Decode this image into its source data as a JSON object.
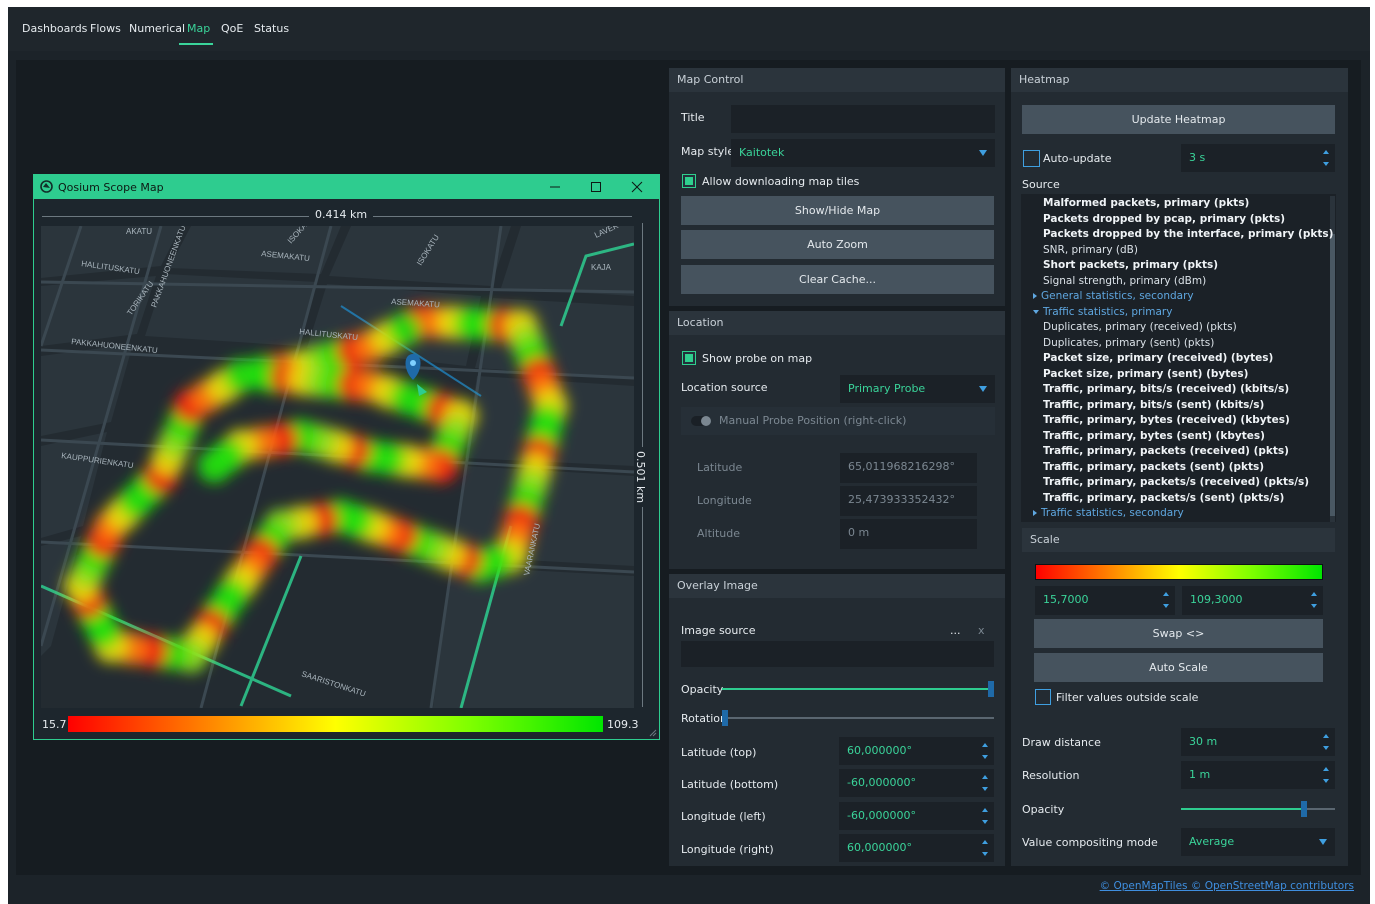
{
  "nav": {
    "items": [
      "Dashboards",
      "Flows",
      "Numerical",
      "Map",
      "QoE",
      "Status"
    ],
    "active": "Map"
  },
  "map_window": {
    "title": "Qosium Scope Map",
    "scale_horizontal": "0.414 km",
    "scale_vertical": "0.501 km",
    "legend_min": "15.7",
    "legend_max": "109.3",
    "streets": [
      "HALLITUSKATU",
      "ASEMAKATU",
      "TORIKATU",
      "ASEMAKATU",
      "HALLITUSKATU",
      "PAKKAHUONEENKATU",
      "KAUPPURIENKATU",
      "VAARANKATU",
      "SAARISTONKATU",
      "ISOKATU",
      "KAJA",
      "LAVEK",
      "ISOKATU",
      "AKATU",
      "PAKKAHUONEENKATU"
    ]
  },
  "map_control": {
    "header": "Map Control",
    "title_label": "Title",
    "title_value": "",
    "map_style_label": "Map style",
    "map_style_value": "Kaitotek",
    "allow_download_label": "Allow downloading map tiles",
    "show_hide_button": "Show/Hide Map",
    "auto_zoom_button": "Auto Zoom",
    "clear_cache_button": "Clear Cache..."
  },
  "location": {
    "header": "Location",
    "show_probe_label": "Show probe on map",
    "source_label": "Location source",
    "source_value": "Primary Probe",
    "manual_label": "Manual Probe Position (right-click)",
    "latitude_label": "Latitude",
    "latitude_value": "65,011968216298°",
    "longitude_label": "Longitude",
    "longitude_value": "25,473933352432°",
    "altitude_label": "Altitude",
    "altitude_value": "0 m"
  },
  "overlay": {
    "header": "Overlay Image",
    "image_source_label": "Image source",
    "browse": "...",
    "clear": "x",
    "opacity_label": "Opacity",
    "opacity_level": 1.0,
    "rotation_label": "Rotation",
    "rotation_level": 0.0,
    "lat_top_label": "Latitude (top)",
    "lat_top_value": "60,000000°",
    "lat_bottom_label": "Latitude (bottom)",
    "lat_bottom_value": "-60,000000°",
    "lon_left_label": "Longitude (left)",
    "lon_left_value": "-60,000000°",
    "lon_right_label": "Longitude (right)",
    "lon_right_value": "60,000000°"
  },
  "heatmap": {
    "header": "Heatmap",
    "update_button": "Update Heatmap",
    "auto_update_label": "Auto-update",
    "auto_update_value": "3 s",
    "source_label": "Source",
    "source_items": [
      {
        "text": "Malformed packets, primary (pkts)",
        "style": "bold"
      },
      {
        "text": "Packets dropped by pcap, primary (pkts)",
        "style": "bold"
      },
      {
        "text": "Packets dropped by the interface, primary (pkts)",
        "style": "bold"
      },
      {
        "text": "SNR, primary (dB)",
        "style": "normal"
      },
      {
        "text": "Short packets, primary (pkts)",
        "style": "bold"
      },
      {
        "text": "Signal strength, primary (dBm)",
        "style": "normal"
      },
      {
        "text": "General statistics, secondary",
        "style": "group-collapsed"
      },
      {
        "text": "Traffic statistics, primary",
        "style": "group-expanded"
      },
      {
        "text": "Duplicates, primary (received) (pkts)",
        "style": "normal"
      },
      {
        "text": "Duplicates, primary (sent) (pkts)",
        "style": "normal"
      },
      {
        "text": "Packet size, primary (received) (bytes)",
        "style": "bold"
      },
      {
        "text": "Packet size, primary (sent) (bytes)",
        "style": "bold"
      },
      {
        "text": "Traffic, primary, bits/s (received) (kbits/s)",
        "style": "bold"
      },
      {
        "text": "Traffic, primary, bits/s (sent) (kbits/s)",
        "style": "bold"
      },
      {
        "text": "Traffic, primary, bytes (received) (kbytes)",
        "style": "bold"
      },
      {
        "text": "Traffic, primary, bytes (sent) (kbytes)",
        "style": "bold"
      },
      {
        "text": "Traffic, primary, packets (received) (pkts)",
        "style": "bold"
      },
      {
        "text": "Traffic, primary, packets (sent) (pkts)",
        "style": "bold"
      },
      {
        "text": "Traffic, primary, packets/s (received) (pkts/s)",
        "style": "bold"
      },
      {
        "text": "Traffic, primary, packets/s (sent) (pkts/s)",
        "style": "bold"
      },
      {
        "text": "Traffic statistics, secondary",
        "style": "group-collapsed"
      }
    ],
    "scale_header": "Scale",
    "scale_min": "15,7000",
    "scale_max": "109,3000",
    "swap_button": "Swap <>",
    "auto_scale_button": "Auto Scale",
    "filter_label": "Filter values outside scale",
    "draw_distance_label": "Draw distance",
    "draw_distance_value": "30 m",
    "resolution_label": "Resolution",
    "resolution_value": "1 m",
    "opacity_label": "Opacity",
    "opacity_level": 0.8,
    "compositing_label": "Value compositing mode",
    "compositing_value": "Average"
  },
  "footer": {
    "attribution": "© OpenMapTiles © OpenStreetMap contributors"
  },
  "colors": {
    "accent": "#2ecc8f",
    "link": "#3f8fe0",
    "background": "#1c2329"
  }
}
